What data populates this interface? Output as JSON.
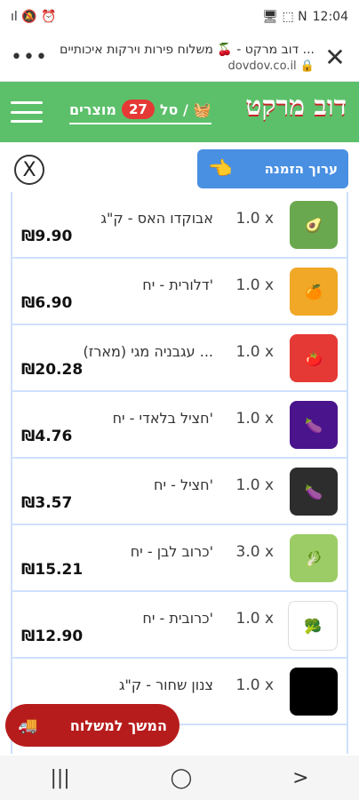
{
  "status": {
    "time": "12:04",
    "left_icons": "ıl 🔕 ⏰",
    "right_icons": "🖥 ⬚ N"
  },
  "browser": {
    "title": "דוב מרקט - 🍒 משלוח פירות וירקות איכותיים ...",
    "domain": "dovdov.co.il",
    "menu_icon": "more-vert",
    "close_icon": "close"
  },
  "header": {
    "logo": "דוב מרקט",
    "cart_label_prefix": "סל /",
    "cart_count": "27",
    "cart_label_suffix": "מוצרים"
  },
  "actions": {
    "order_button": "ערוך הזמנה",
    "close_symbol": "X"
  },
  "cart_items": [
    {
      "name": "אבוקדו האס - ק\"ג",
      "qty": "1.0 x",
      "price": "₪9.90",
      "icon": "avocado"
    },
    {
      "name": "דלורית - יח'",
      "qty": "1.0 x",
      "price": "₪6.90",
      "icon": "papaya"
    },
    {
      "name": "עגבניה מגי (מארז) ...",
      "qty": "1.0 x",
      "price": "₪20.28",
      "icon": "tomato"
    },
    {
      "name": "חציל בלאדי - יח'",
      "qty": "1.0 x",
      "price": "₪4.76",
      "icon": "eggplant1"
    },
    {
      "name": "חציל - יח'",
      "qty": "1.0 x",
      "price": "₪3.57",
      "icon": "eggplant2"
    },
    {
      "name": "כרוב לבן - יח'",
      "qty": "3.0 x",
      "price": "₪15.21",
      "icon": "cabbage"
    },
    {
      "name": "כרובית - יח'",
      "qty": "1.0 x",
      "price": "₪12.90",
      "icon": "cauliflower"
    },
    {
      "name": "צנון שחור - ק\"ג",
      "qty": "1.0 x",
      "price": "",
      "icon": "radish"
    }
  ],
  "footer": {
    "continue_label": "המשך למשלוח",
    "truck_icon": "truck"
  },
  "nav": {
    "recent": "|||",
    "home": "◯",
    "back": ">"
  }
}
